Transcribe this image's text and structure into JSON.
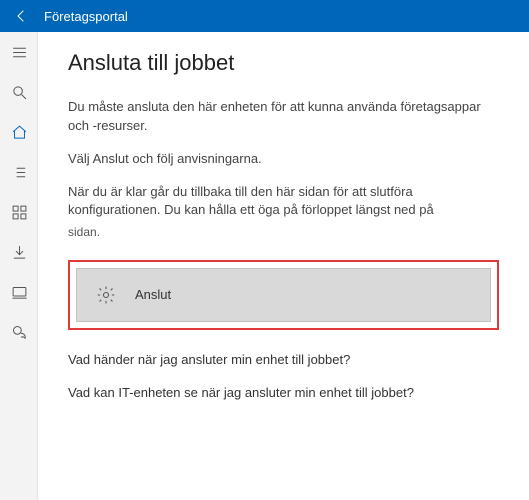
{
  "titlebar": {
    "title": "Företagsportal"
  },
  "page": {
    "heading": "Ansluta till jobbet",
    "para1": "Du måste ansluta den här enheten för att kunna använda företagsappar och -resurser.",
    "para2": "Välj Anslut och följ anvisningarna.",
    "para3": "När du är klar går du tillbaka till den här sidan för att slutföra konfigurationen. Du kan hålla ett öga på förloppet längst ned på",
    "para3_trail": "sidan.",
    "connect_label": "Anslut",
    "question1": "Vad händer när jag ansluter min enhet till jobbet?",
    "question2": "Vad kan IT-enheten se när jag ansluter min enhet till jobbet?"
  }
}
